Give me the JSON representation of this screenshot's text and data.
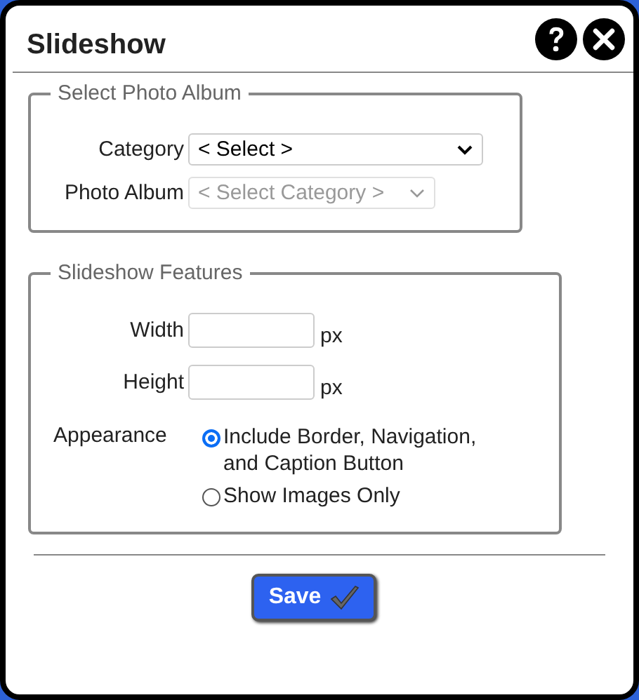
{
  "window": {
    "title": "Slideshow"
  },
  "album": {
    "legend": "Select Photo Album",
    "category": {
      "label": "Category",
      "value": "< Select >",
      "disabled": false
    },
    "photo_album": {
      "label": "Photo Album",
      "value": "< Select Category >",
      "disabled": true
    }
  },
  "features": {
    "legend": "Slideshow Features",
    "fields": [
      {
        "label": "Width",
        "unit": "px"
      },
      {
        "label": "Height",
        "unit": "px"
      }
    ],
    "appearance": {
      "label": "Appearance",
      "options": [
        {
          "label": "Include Border, Navigation, and Caption Button",
          "selected": true
        },
        {
          "label": "Show Images Only",
          "selected": false
        }
      ]
    }
  },
  "save_button": "Save"
}
